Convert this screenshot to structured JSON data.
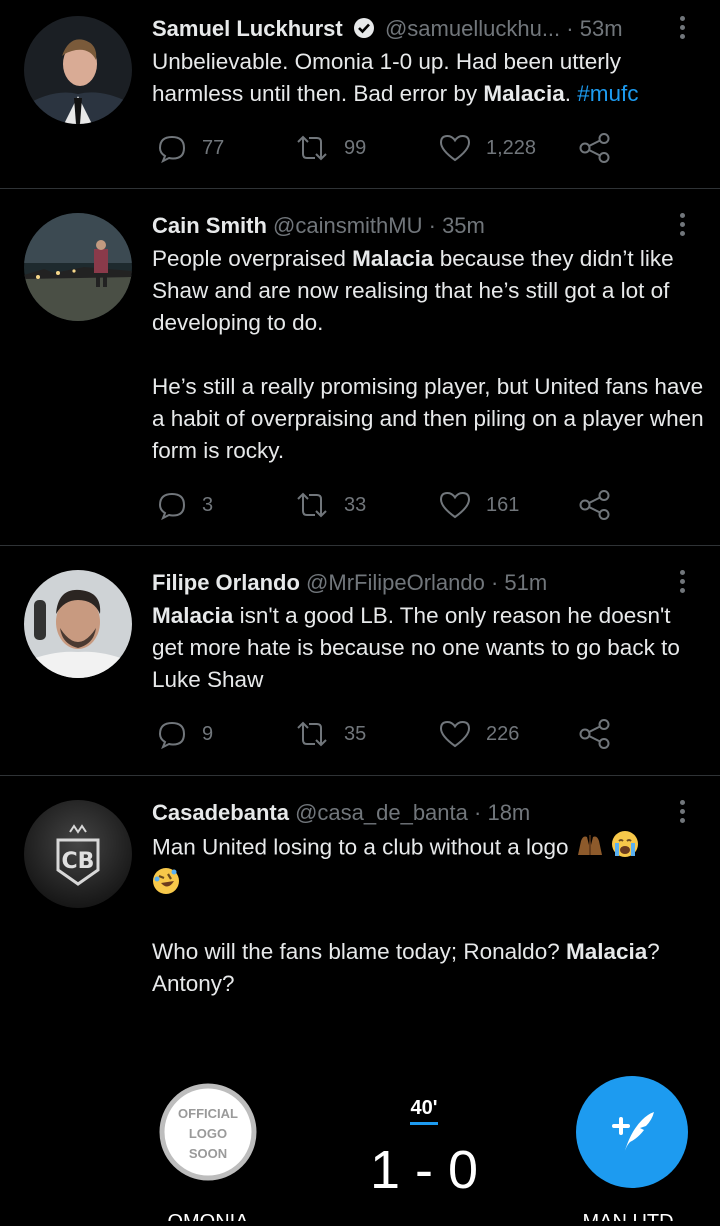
{
  "tweets": [
    {
      "name": "Samuel Luckhurst",
      "verified": true,
      "handle": "@samuelluckhu...",
      "time": "· 53m",
      "text_parts": [
        "Unbelievable. Omonia 1-0 up. Had been utterly harmless until then. Bad error by ",
        "Malacia",
        ". ",
        "#mufc"
      ],
      "replies": "77",
      "retweets": "99",
      "likes": "1,228"
    },
    {
      "name": "Cain Smith",
      "handle": "@cainsmithMU",
      "time": "· 35m",
      "text_parts": [
        "People overpraised ",
        "Malacia",
        " because they didn’t like Shaw and are now realising that he’s still got a lot of developing to do.",
        "He’s still a really promising player, but United fans have a habit of overpraising and then piling on a player when form is rocky."
      ],
      "replies": "3",
      "retweets": "33",
      "likes": "161"
    },
    {
      "name": "Filipe Orlando",
      "handle": "@MrFilipeOrlando",
      "time": "· 51m",
      "text_parts": [
        "Malacia",
        " isn't a good LB. The only reason he doesn't get more hate is because no one wants to go back to Luke Shaw"
      ],
      "replies": "9",
      "retweets": "35",
      "likes": "226"
    },
    {
      "name": "Casadebanta",
      "handle": "@casa_de_banta",
      "time": "· 18m",
      "text_parts": [
        "Man United losing to a club without a logo ",
        "Who will the fans blame today; Ronaldo? ",
        "Malacia",
        "? Antony?"
      ],
      "avatar_text": "CB"
    }
  ],
  "scorecard": {
    "minute": "40'",
    "score": "1 - 0",
    "home_logo_lines": [
      "OFFICIAL",
      "LOGO",
      "SOON"
    ],
    "home": "OMONIA",
    "away": "MAN UTD"
  },
  "colors": {
    "accent": "#1d9bf0",
    "muted": "#71767b",
    "text": "#e7e9ea",
    "divider": "#2f3336"
  },
  "icons": [
    "reply-icon",
    "retweet-icon",
    "like-icon",
    "share-icon",
    "more-icon",
    "verified-icon",
    "compose-icon"
  ]
}
